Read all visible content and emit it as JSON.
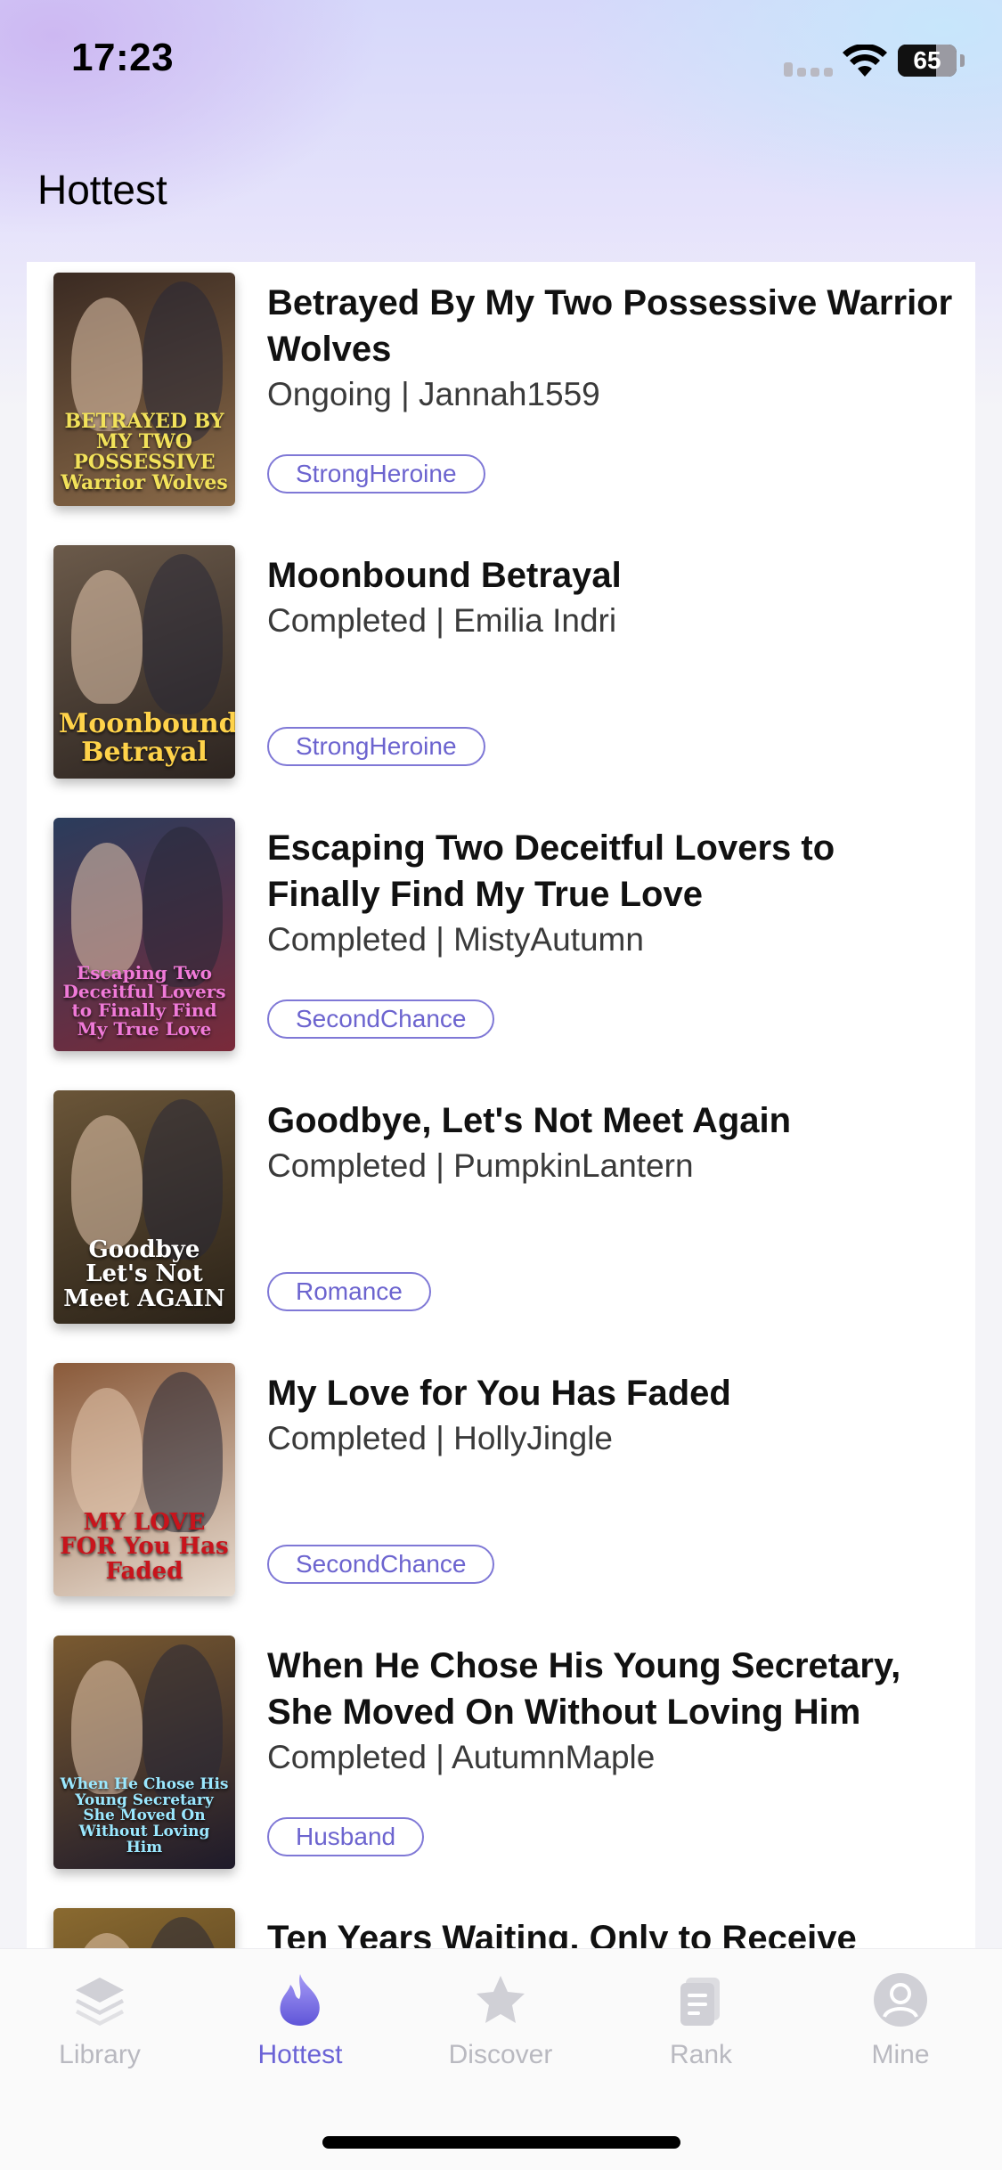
{
  "status_bar": {
    "time": "17:23",
    "battery": "65",
    "battery_level": 0.65
  },
  "header": {
    "title": "Hottest"
  },
  "books": [
    {
      "title": "Betrayed By My Two Possessive Warrior Wolves",
      "status": "Ongoing",
      "author": "Jannah1559",
      "meta": "Ongoing | Jannah1559",
      "tag": "StrongHeroine",
      "cover_text": "BETRAYED BY MY TWO POSSESSIVE Warrior Wolves",
      "cover_colors": [
        "#3a2a22",
        "#8a6a48"
      ],
      "cover_text_color": "#f2e25a"
    },
    {
      "title": "Moonbound Betrayal",
      "status": "Completed",
      "author": "Emilia Indri",
      "meta": "Completed | Emilia Indri",
      "tag": "StrongHeroine",
      "cover_text": "Moonbound Betrayal",
      "cover_colors": [
        "#6b5a4a",
        "#2c2420"
      ],
      "cover_text_color": "#ffd34a"
    },
    {
      "title": "Escaping Two Deceitful Lovers to Finally Find My True Love",
      "status": "Completed",
      "author": "MistyAutumn",
      "meta": "Completed | MistyAutumn",
      "tag": "SecondChance",
      "cover_text": "Escaping Two Deceitful Lovers to Finally Find My True Love",
      "cover_colors": [
        "#2a3c5c",
        "#7a2a3a"
      ],
      "cover_text_color": "#f07ad8"
    },
    {
      "title": "Goodbye, Let's Not Meet Again",
      "status": "Completed",
      "author": "PumpkinLantern",
      "meta": "Completed | PumpkinLantern",
      "tag": "Romance",
      "cover_text": "Goodbye Let's Not Meet AGAIN",
      "cover_colors": [
        "#6a5538",
        "#2a2218"
      ],
      "cover_text_color": "#ffffff"
    },
    {
      "title": "My Love for You Has Faded",
      "status": "Completed",
      "author": "HollyJingle",
      "meta": "Completed | HollyJingle",
      "tag": "SecondChance",
      "cover_text": "MY LOVE FOR You Has Faded",
      "cover_colors": [
        "#8a5a3a",
        "#e8dcd0"
      ],
      "cover_text_color": "#c8141c"
    },
    {
      "title": "When He Chose His Young Secretary, She Moved On Without Loving Him",
      "status": "Completed",
      "author": "AutumnMaple",
      "meta": "Completed | AutumnMaple",
      "tag": "Husband",
      "cover_text": "When He Chose His Young Secretary She Moved On Without Loving Him",
      "cover_colors": [
        "#7a5a30",
        "#1e1a2a"
      ],
      "cover_text_color": "#9be8ff"
    },
    {
      "title": "Ten Years Waiting, Only to Receive",
      "status": "",
      "author": "",
      "meta": "",
      "tag": "",
      "cover_text": "",
      "cover_colors": [
        "#8a6a30",
        "#3a2a18"
      ],
      "cover_text_color": "#ffffff"
    }
  ],
  "tabs": [
    {
      "label": "Library",
      "icon": "stack-layers-icon",
      "active": false
    },
    {
      "label": "Hottest",
      "icon": "flame-icon",
      "active": true
    },
    {
      "label": "Discover",
      "icon": "star-icon",
      "active": false
    },
    {
      "label": "Rank",
      "icon": "documents-icon",
      "active": false
    },
    {
      "label": "Mine",
      "icon": "user-avatar-icon",
      "active": false
    }
  ],
  "colors": {
    "accent": "#6b63d6",
    "tag_border": "#7f78d6",
    "inactive": "#b9b9c0"
  }
}
